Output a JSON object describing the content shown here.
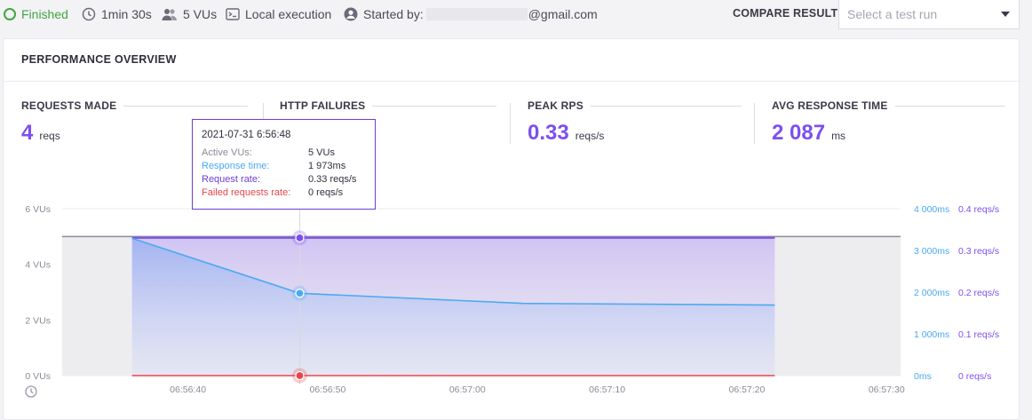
{
  "topbar": {
    "status": "Finished",
    "duration": "1min 30s",
    "vus": "5 VUs",
    "execution": "Local execution",
    "started_by_prefix": "Started by:",
    "started_by_suffix": "@gmail.com",
    "compare_label": "COMPARE RESULT",
    "compare_placeholder": "Select a test run"
  },
  "overview": {
    "title": "PERFORMANCE OVERVIEW",
    "metrics": [
      {
        "label": "REQUESTS MADE",
        "value": "4",
        "unit": "reqs"
      },
      {
        "label": "HTTP FAILURES",
        "value": "",
        "unit": "reqs"
      },
      {
        "label": "PEAK RPS",
        "value": "0.33",
        "unit": "reqs/s"
      },
      {
        "label": "AVG RESPONSE TIME",
        "value": "2 087",
        "unit": "ms"
      }
    ]
  },
  "tooltip": {
    "time": "2021-07-31 6:56:48",
    "rows": [
      {
        "label": "Active VUs:",
        "value": "5 VUs",
        "color": "#8a8a96"
      },
      {
        "label": "Response time:",
        "value": "1 973ms",
        "color": "#4aaaf0"
      },
      {
        "label": "Request rate:",
        "value": "0.33 reqs/s",
        "color": "#6b3fd4"
      },
      {
        "label": "Failed requests rate:",
        "value": "0 reqs/s",
        "color": "#e8454a"
      }
    ]
  },
  "colors": {
    "vus": "#8a8a96",
    "response_time": "#4aaaf0",
    "request_rate": "#7d4ff0",
    "failed_rate": "#e8454a",
    "status_ok": "#3fa83f"
  },
  "chart_data": {
    "type": "line",
    "x_ticks": [
      "06:56:40",
      "06:56:50",
      "06:57:00",
      "06:57:10",
      "06:57:20",
      "06:57:30"
    ],
    "y_left_ticks": [
      "0 VUs",
      "2 VUs",
      "4 VUs",
      "6 VUs"
    ],
    "y_right_ms_ticks": [
      "0ms",
      "1 000ms",
      "2 000ms",
      "3 000ms",
      "4 000ms"
    ],
    "y_right_rps_ticks": [
      "0 reqs/s",
      "0.1 reqs/s",
      "0.2 reqs/s",
      "0.3 reqs/s",
      "0.4 reqs/s"
    ],
    "series": [
      {
        "key": "vus",
        "axis": "vus",
        "x": [
          "06:56:31",
          "06:57:31"
        ],
        "y": [
          5,
          5
        ]
      },
      {
        "key": "response_time",
        "axis": "ms",
        "x": [
          "06:56:36",
          "06:56:48",
          "06:57:04",
          "06:57:22"
        ],
        "y": [
          3290,
          1973,
          1730,
          1690
        ]
      },
      {
        "key": "request_rate",
        "axis": "rps",
        "x": [
          "06:56:36",
          "06:57:22"
        ],
        "y": [
          0.33,
          0.33
        ]
      },
      {
        "key": "failed_rate",
        "axis": "rps",
        "x": [
          "06:56:36",
          "06:57:22"
        ],
        "y": [
          0,
          0
        ]
      }
    ],
    "vus_range": [
      0,
      6
    ],
    "ms_range": [
      0,
      4000
    ],
    "rps_range": [
      0,
      0.4
    ],
    "hover_x": "06:56:48"
  }
}
